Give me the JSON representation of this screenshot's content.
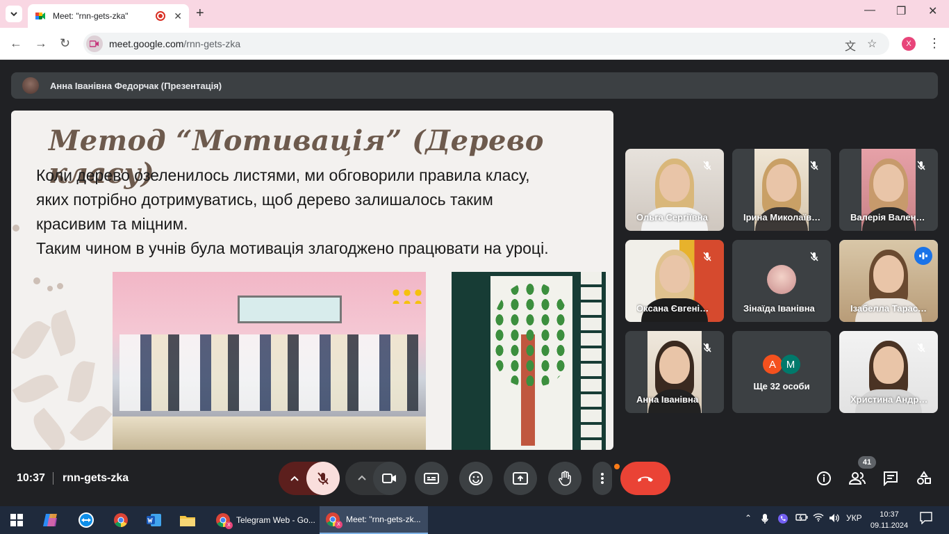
{
  "browser": {
    "tab_title": "Meet: \"rnn-gets-zka\"",
    "url_host": "meet.google.com",
    "url_path": "/rnn-gets-zka",
    "profile_initial": "X"
  },
  "presenter": {
    "label": "Анна Іванівна Федорчак (Презентація)"
  },
  "slide": {
    "title": "Метод “Мотивація” (Дерево класу)",
    "line1": "Коли дерево озеленилось листями, ми обговорили правила класу,",
    "line2": "яких потрібно дотримуватись, щоб дерево залишалось таким",
    "line3": "красивим та міцним.",
    "line4": "Таким чином в учнів була мотивація злагоджено працювати на уроці."
  },
  "participants": [
    {
      "name": "Ольга Сергіївна"
    },
    {
      "name": "Ірина Миколаївна"
    },
    {
      "name": "Валерія Валентинівна"
    },
    {
      "name": "Оксана Євгенівна"
    },
    {
      "name": "Зінаїда Іванівна"
    },
    {
      "name": "Ізабелла Тарасівна"
    },
    {
      "name": "Анна Іванівна"
    },
    {
      "name": "Христина Андріївна"
    }
  ],
  "more": {
    "label": "Ще 32 особи",
    "avatar1": "A",
    "avatar2": "M",
    "avatar1_color": "#f4511e",
    "avatar2_color": "#00796b"
  },
  "meeting": {
    "time": "10:37",
    "code": "rnn-gets-zka",
    "people_count": "41"
  },
  "taskbar": {
    "telegram_label": "Telegram Web - Go...",
    "meet_label": "Meet: \"rnn-gets-zk...",
    "lang": "УКР",
    "time": "10:37",
    "date": "09.11.2024"
  },
  "colors": {
    "end_call": "#ea4335",
    "mic_off_bg": "#f9dedc",
    "accent_blue": "#8ab4f8"
  }
}
